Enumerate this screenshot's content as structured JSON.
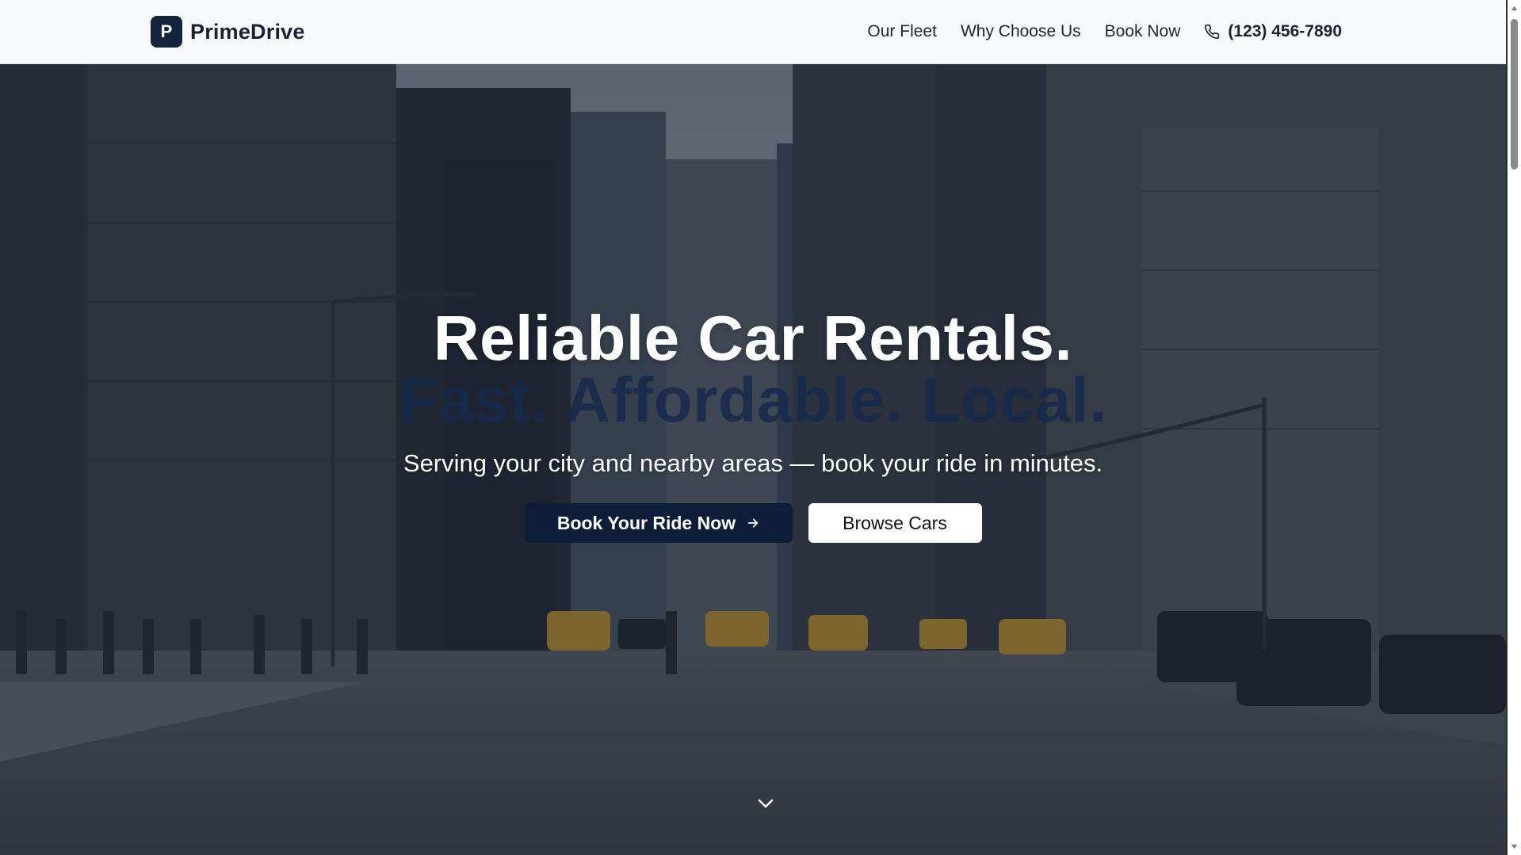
{
  "brand": {
    "logo_letter": "P",
    "name": "PrimeDrive"
  },
  "nav": {
    "links": [
      "Our Fleet",
      "Why Choose Us",
      "Book Now"
    ],
    "phone": "(123) 456-7890"
  },
  "hero": {
    "headline_line1": "Reliable Car Rentals.",
    "headline_line2": "Fast. Affordable. Local.",
    "subheadline": "Serving your city and nearby areas — book your ride in minutes.",
    "primary_cta": "Book Your Ride Now",
    "secondary_cta": "Browse Cars"
  },
  "icons": {
    "phone": "phone-icon",
    "arrow": "arrow-right-icon",
    "scroll": "chevron-down-icon"
  },
  "colors": {
    "brand_navy": "#0f1e38",
    "header_bg": "#f8f9fa",
    "hero_overlay": "rgba(30,38,52,0.45)",
    "headline_white": "#ffffff",
    "headline_accent": "#17294d"
  }
}
